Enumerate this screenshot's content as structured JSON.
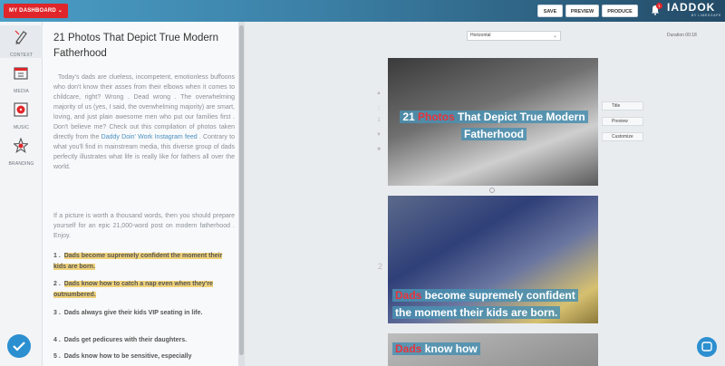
{
  "topbar": {
    "dashboard_label": "MY DASHBOARD",
    "save_label": "SAVE",
    "preview_label": "PREVIEW",
    "produce_label": "PRODUCE",
    "notification_count": "1",
    "logo_text": "IADDOK",
    "logo_subtext": "BY LIMESGAPE"
  },
  "sidebar": {
    "items": [
      {
        "label": "Context",
        "icon": "pencil-icon"
      },
      {
        "label": "Media",
        "icon": "film-icon"
      },
      {
        "label": "Music",
        "icon": "music-icon"
      },
      {
        "label": "Branding",
        "icon": "star-icon"
      }
    ]
  },
  "article": {
    "title": "21 Photos That Depict True Modern Fatherhood",
    "para1_before": "Today's dads are clueless, incompetent, emotionless buffoons who don't know their asses from their elbows when it comes to childcare, right? Wrong .  Dead wrong .  The overwhelming majority of us (yes, I said, the overwhelming majority) are smart, loving, and just plain awesome men who put our families first .  Don't believe me? Check out this compilation of photos taken directly from the ",
    "para1_link": "Daddy Doin' Work Instagram feed",
    "para1_after": " .  Contrary to what you'll find in mainstream media, this diverse group of dads perfectly illustrates what life is really like for fathers all over the world.",
    "para2": "If a picture is worth a thousand words, then you should prepare yourself for an epic 21,000-word post on modern fatherhood .  Enjoy.",
    "list": [
      {
        "num": "1 .",
        "text": "Dads become supremely confident the moment their kids are born.",
        "highlight": true
      },
      {
        "num": "2 .",
        "text": "Dads know how to catch a nap even when they're outnumbered.",
        "highlight": true
      },
      {
        "num": "3 .",
        "text": "Dads always give their kids VIP seating in life.",
        "highlight": false
      },
      {
        "num": "4 .",
        "text": "Dads get pedicures with their daughters.",
        "highlight": false
      },
      {
        "num": "5 .",
        "text": "Dads know how to be sensitive, especially",
        "highlight": false
      }
    ]
  },
  "canvas": {
    "orientation": "Horizontal",
    "duration": "Duration 00:18",
    "slide1": {
      "red": "Photos",
      "pre": "21 ",
      "post": " That Depict True Modern Fatherhood"
    },
    "slide2": {
      "red": "Dads",
      "post": " become supremely confident the moment their kids are born."
    },
    "slide3": {
      "red": "Dads",
      "post": " know how"
    },
    "slide_number": "2",
    "controls": {
      "title": "Title",
      "preview": "Preview",
      "customize": "Customize"
    }
  },
  "colors": {
    "accent": "#2b8fd0",
    "brand_red": "#e0262a",
    "highlight": "#f0d27a",
    "caption_box": "#4a90b2"
  }
}
